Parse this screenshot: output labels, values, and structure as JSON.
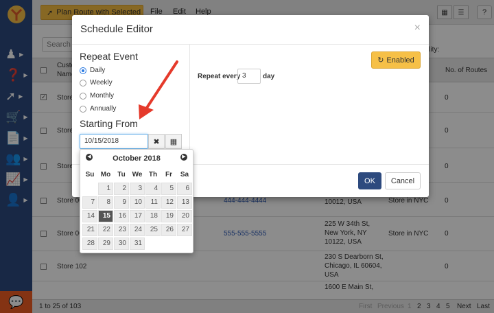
{
  "topbar": {
    "plan_button": "Plan Route with Selected",
    "menu": [
      "File",
      "Edit",
      "Help"
    ],
    "help": "?"
  },
  "grid": {
    "search_placeholder": "Search in",
    "columns": [
      "Custo",
      "Name",
      "No. of Routes"
    ],
    "availability_label": "ility:",
    "rows": [
      {
        "name": "Store",
        "phone": "",
        "address": "",
        "group": "",
        "routes": "0",
        "checked": true
      },
      {
        "name": "Store",
        "phone": "",
        "address": "",
        "group": "",
        "routes": "0",
        "checked": false
      },
      {
        "name": "Store",
        "phone": "",
        "address": "",
        "group": "",
        "routes": "0",
        "checked": false
      },
      {
        "name": "Store 00",
        "phone": "444-444-4444",
        "address": "10012, USA",
        "group": "Store in NYC",
        "routes": "0",
        "checked": false
      },
      {
        "name": "Store 00",
        "phone": "555-555-5555",
        "address": "225 W 34th St, New York, NY 10122, USA",
        "group": "Store in NYC",
        "routes": "0",
        "checked": false
      },
      {
        "name": "Store 102",
        "phone": "",
        "address": "230 S Dearborn St, Chicago, IL 60604, USA",
        "group": "",
        "routes": "0",
        "checked": false
      },
      {
        "name": "",
        "phone": "",
        "address": "1600 E Main St,",
        "group": "",
        "routes": "",
        "checked": false
      }
    ],
    "footer_count": "1 to 25 of 103",
    "pager": {
      "first": "First",
      "previous": "Previous",
      "pages": [
        "1",
        "2",
        "3",
        "4",
        "5"
      ],
      "next": "Next",
      "last": "Last"
    }
  },
  "modal": {
    "title": "Schedule Editor",
    "close": "×",
    "repeat_heading": "Repeat Event",
    "options": [
      "Daily",
      "Weekly",
      "Monthly",
      "Annually"
    ],
    "selected_option": "Daily",
    "starting_heading": "Starting From",
    "date_value": "10/15/2018",
    "repeat_every_label": "Repeat every",
    "repeat_every_value": "3",
    "repeat_unit": "day",
    "enabled_button": "Enabled",
    "ok_button": "OK",
    "cancel_button": "Cancel"
  },
  "calendar": {
    "month_title": "October 2018",
    "weekdays": [
      "Su",
      "Mo",
      "Tu",
      "We",
      "Th",
      "Fr",
      "Sa"
    ],
    "weeks": [
      [
        "",
        "1",
        "2",
        "3",
        "4",
        "5",
        "6"
      ],
      [
        "7",
        "8",
        "9",
        "10",
        "11",
        "12",
        "13"
      ],
      [
        "14",
        "15",
        "16",
        "17",
        "18",
        "19",
        "20"
      ],
      [
        "21",
        "22",
        "23",
        "24",
        "25",
        "26",
        "27"
      ],
      [
        "28",
        "29",
        "30",
        "31",
        "",
        "",
        ""
      ]
    ],
    "selected_day": "15"
  },
  "colors": {
    "sidebar": "#2d4a7e",
    "accent_yellow": "#f6c047",
    "primary_blue": "#2d4a7e",
    "arrow_red": "#e53a2b",
    "chat_orange": "#f05d23"
  }
}
